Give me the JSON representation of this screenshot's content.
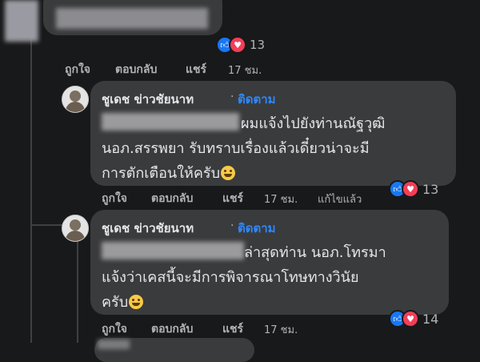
{
  "top_comment": {
    "reactions": {
      "count": "13"
    },
    "actions": {
      "like": "ถูกใจ",
      "reply": "ตอบกลับ",
      "share": "แชร์"
    },
    "time": "17 ชม."
  },
  "reply1": {
    "author": "ชูเดช ข่าวชัยนาท",
    "separator": "·",
    "follow": "ติดตาม",
    "line1": "ผมแจ้งไปยังท่านณัฐวุฒิ",
    "line2": "นอภ.สรรพยา รับทราบเรื่องแล้วเดี๋ยวน่าจะมี",
    "line3": "การตักเตือนให้ครับ",
    "actions": {
      "like": "ถูกใจ",
      "reply": "ตอบกลับ",
      "share": "แชร์"
    },
    "time": "17 ชม.",
    "edited": "แก้ไขแล้ว",
    "reactions": {
      "count": "13"
    }
  },
  "reply2": {
    "author": "ชูเดช ข่าวชัยนาท",
    "separator": "·",
    "follow": "ติดตาม",
    "line1": "ล่าสุดท่าน นอภ.โทรมา",
    "line2": "แจ้งว่าเคสนี้จะมีการพิจารณาโทษทางวินัย",
    "line3": "ครับ",
    "actions": {
      "like": "ถูกใจ",
      "reply": "ตอบกลับ",
      "share": "แชร์"
    },
    "time": "17 ชม.",
    "reactions": {
      "count": "14"
    }
  },
  "icons": {
    "like": "thumbs-up-icon",
    "love": "heart-icon",
    "emoji": "smiling-face-icon"
  },
  "colors": {
    "background": "#18191a",
    "bubble": "#3a3b3c",
    "link": "#2d88ff",
    "like": "#1877f2",
    "love": "#f33e58"
  }
}
